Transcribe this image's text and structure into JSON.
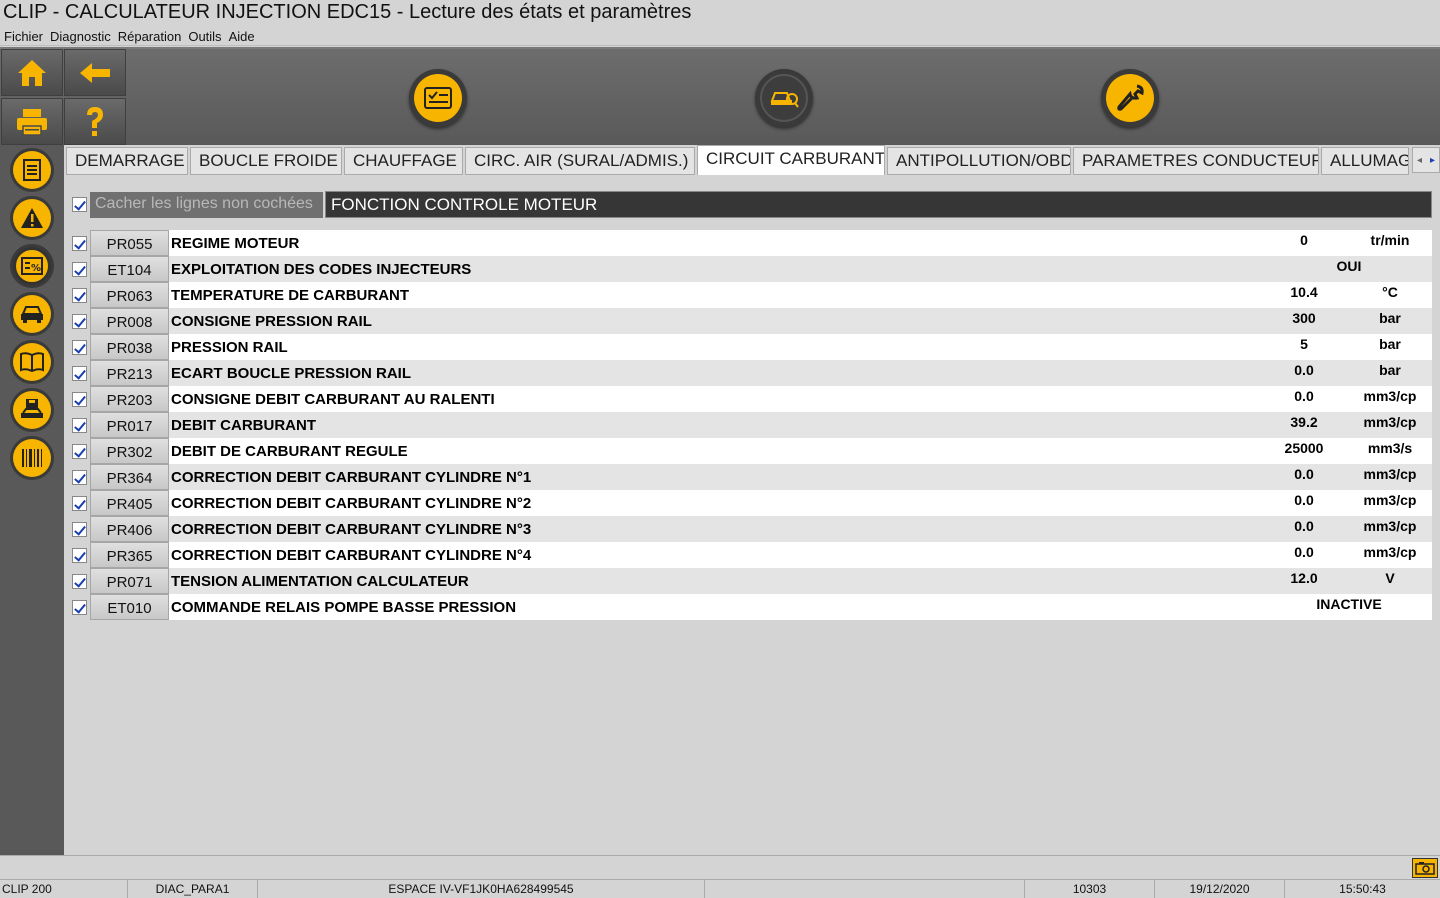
{
  "window": {
    "title": "CLIP - CALCULATEUR INJECTION EDC15 - Lecture des états et paramètres"
  },
  "menu": [
    "Fichier",
    "Diagnostic",
    "Réparation",
    "Outils",
    "Aide"
  ],
  "tabs": [
    {
      "label": "DEMARRAGE"
    },
    {
      "label": "BOUCLE FROIDE"
    },
    {
      "label": "CHAUFFAGE"
    },
    {
      "label": "CIRC. AIR (SURAL/ADMIS.)"
    },
    {
      "label": "CIRCUIT CARBURANT"
    },
    {
      "label": "ANTIPOLLUTION/OBD"
    },
    {
      "label": "PARAMETRES CONDUCTEUR"
    },
    {
      "label": "ALLUMAGE"
    }
  ],
  "active_tab": "CIRCUIT CARBURANT",
  "filter": {
    "hide_unchecked_label": "Cacher les lignes non cochées",
    "function_label": "FONCTION CONTROLE MOTEUR"
  },
  "rows": [
    {
      "code": "PR055",
      "label": "REGIME MOTEUR",
      "value": "0",
      "unit": "tr/min"
    },
    {
      "code": "ET104",
      "label": "EXPLOITATION DES CODES INJECTEURS",
      "value": "OUI",
      "unit": ""
    },
    {
      "code": "PR063",
      "label": "TEMPERATURE DE CARBURANT",
      "value": "10.4",
      "unit": "°C"
    },
    {
      "code": "PR008",
      "label": "CONSIGNE PRESSION RAIL",
      "value": "300",
      "unit": "bar"
    },
    {
      "code": "PR038",
      "label": "PRESSION RAIL",
      "value": "5",
      "unit": "bar"
    },
    {
      "code": "PR213",
      "label": "ECART BOUCLE PRESSION RAIL",
      "value": "0.0",
      "unit": "bar"
    },
    {
      "code": "PR203",
      "label": "CONSIGNE DEBIT CARBURANT AU RALENTI",
      "value": "0.0",
      "unit": "mm3/cp"
    },
    {
      "code": "PR017",
      "label": "DEBIT CARBURANT",
      "value": "39.2",
      "unit": "mm3/cp"
    },
    {
      "code": "PR302",
      "label": "DEBIT DE CARBURANT REGULE",
      "value": "25000",
      "unit": "mm3/s"
    },
    {
      "code": "PR364",
      "label": "CORRECTION DEBIT CARBURANT CYLINDRE N°1",
      "value": "0.0",
      "unit": "mm3/cp"
    },
    {
      "code": "PR405",
      "label": "CORRECTION DEBIT CARBURANT CYLINDRE N°2",
      "value": "0.0",
      "unit": "mm3/cp"
    },
    {
      "code": "PR406",
      "label": "CORRECTION DEBIT CARBURANT CYLINDRE N°3",
      "value": "0.0",
      "unit": "mm3/cp"
    },
    {
      "code": "PR365",
      "label": "CORRECTION DEBIT CARBURANT CYLINDRE N°4",
      "value": "0.0",
      "unit": "mm3/cp"
    },
    {
      "code": "PR071",
      "label": "TENSION ALIMENTATION CALCULATEUR",
      "value": "12.0",
      "unit": "V"
    },
    {
      "code": "ET010",
      "label": "COMMANDE RELAIS POMPE BASSE PRESSION",
      "value": "INACTIVE",
      "unit": ""
    }
  ],
  "status": {
    "tool": "CLIP 200",
    "session": "DIAC_PARA1",
    "vehicle": "ESPACE IV-VF1JK0HA628499545",
    "counter": "10303",
    "date": "19/12/2020",
    "time": "15:50:43"
  },
  "colors": {
    "accent": "#f7b500",
    "toolbar": "#595959",
    "function_header": "#363636"
  }
}
